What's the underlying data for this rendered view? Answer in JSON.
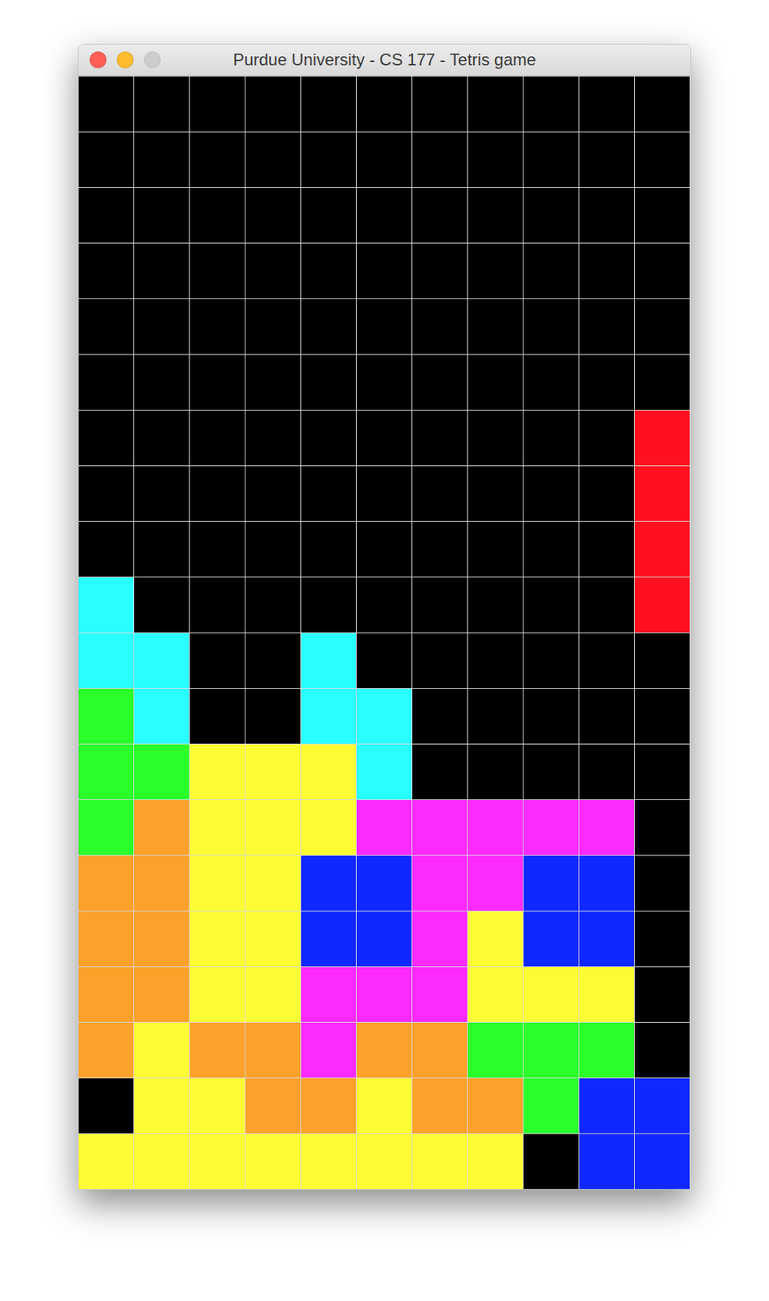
{
  "window": {
    "title": "Purdue University - CS 177 - Tetris game",
    "controls": [
      {
        "name": "close",
        "disabled": false,
        "color": "#fe5f57"
      },
      {
        "name": "minimize",
        "disabled": false,
        "color": "#febc2e"
      },
      {
        "name": "zoom",
        "disabled": true,
        "color": "#cdcdcd"
      }
    ]
  },
  "board": {
    "rows": [
      [
        "#000000",
        "#000000",
        "#000000",
        "#000000",
        "#000000",
        "#000000",
        "#000000",
        "#000000",
        "#000000",
        "#000000",
        "#000000"
      ],
      [
        "#000000",
        "#000000",
        "#000000",
        "#000000",
        "#000000",
        "#000000",
        "#000000",
        "#000000",
        "#000000",
        "#000000",
        "#000000"
      ],
      [
        "#000000",
        "#000000",
        "#000000",
        "#000000",
        "#000000",
        "#000000",
        "#000000",
        "#000000",
        "#000000",
        "#000000",
        "#000000"
      ],
      [
        "#000000",
        "#000000",
        "#000000",
        "#000000",
        "#000000",
        "#000000",
        "#000000",
        "#000000",
        "#000000",
        "#000000",
        "#000000"
      ],
      [
        "#000000",
        "#000000",
        "#000000",
        "#000000",
        "#000000",
        "#000000",
        "#000000",
        "#000000",
        "#000000",
        "#000000",
        "#000000"
      ],
      [
        "#000000",
        "#000000",
        "#000000",
        "#000000",
        "#000000",
        "#000000",
        "#000000",
        "#000000",
        "#000000",
        "#000000",
        "#000000"
      ],
      [
        "#000000",
        "#000000",
        "#000000",
        "#000000",
        "#000000",
        "#000000",
        "#000000",
        "#000000",
        "#000000",
        "#000000",
        "#ff1020"
      ],
      [
        "#000000",
        "#000000",
        "#000000",
        "#000000",
        "#000000",
        "#000000",
        "#000000",
        "#000000",
        "#000000",
        "#000000",
        "#ff1020"
      ],
      [
        "#000000",
        "#000000",
        "#000000",
        "#000000",
        "#000000",
        "#000000",
        "#000000",
        "#000000",
        "#000000",
        "#000000",
        "#ff1020"
      ],
      [
        "#2affff",
        "#000000",
        "#000000",
        "#000000",
        "#000000",
        "#000000",
        "#000000",
        "#000000",
        "#000000",
        "#000000",
        "#ff1020"
      ],
      [
        "#2affff",
        "#2affff",
        "#000000",
        "#000000",
        "#2affff",
        "#000000",
        "#000000",
        "#000000",
        "#000000",
        "#000000",
        "#000000"
      ],
      [
        "#2aff2a",
        "#2affff",
        "#000000",
        "#000000",
        "#2affff",
        "#2affff",
        "#000000",
        "#000000",
        "#000000",
        "#000000",
        "#000000"
      ],
      [
        "#2aff2a",
        "#2aff2a",
        "#fcfc35",
        "#fcfc35",
        "#fcfc35",
        "#2affff",
        "#000000",
        "#000000",
        "#000000",
        "#000000",
        "#000000"
      ],
      [
        "#2aff2a",
        "#fca22a",
        "#fcfc35",
        "#fcfc35",
        "#fcfc35",
        "#fc2afc",
        "#fc2afc",
        "#fc2afc",
        "#fc2afc",
        "#fc2afc",
        "#000000"
      ],
      [
        "#fca22a",
        "#fca22a",
        "#fcfc35",
        "#fcfc35",
        "#1028ff",
        "#1028ff",
        "#fc2afc",
        "#fc2afc",
        "#1028ff",
        "#1028ff",
        "#000000"
      ],
      [
        "#fca22a",
        "#fca22a",
        "#fcfc35",
        "#fcfc35",
        "#1028ff",
        "#1028ff",
        "#fc2afc",
        "#fcfc35",
        "#1028ff",
        "#1028ff",
        "#000000"
      ],
      [
        "#fca22a",
        "#fca22a",
        "#fcfc35",
        "#fcfc35",
        "#fc2afc",
        "#fc2afc",
        "#fc2afc",
        "#fcfc35",
        "#fcfc35",
        "#fcfc35",
        "#000000"
      ],
      [
        "#fca22a",
        "#fcfc35",
        "#fca22a",
        "#fca22a",
        "#fc2afc",
        "#fca22a",
        "#fca22a",
        "#2aff2a",
        "#2aff2a",
        "#2aff2a",
        "#000000"
      ],
      [
        "#000000",
        "#fcfc35",
        "#fcfc35",
        "#fca22a",
        "#fca22a",
        "#fcfc35",
        "#fca22a",
        "#fca22a",
        "#2aff2a",
        "#1028ff",
        "#1028ff"
      ],
      [
        "#fcfc35",
        "#fcfc35",
        "#fcfc35",
        "#fcfc35",
        "#fcfc35",
        "#fcfc35",
        "#fcfc35",
        "#fcfc35",
        "#000000",
        "#1028ff",
        "#1028ff"
      ]
    ]
  }
}
